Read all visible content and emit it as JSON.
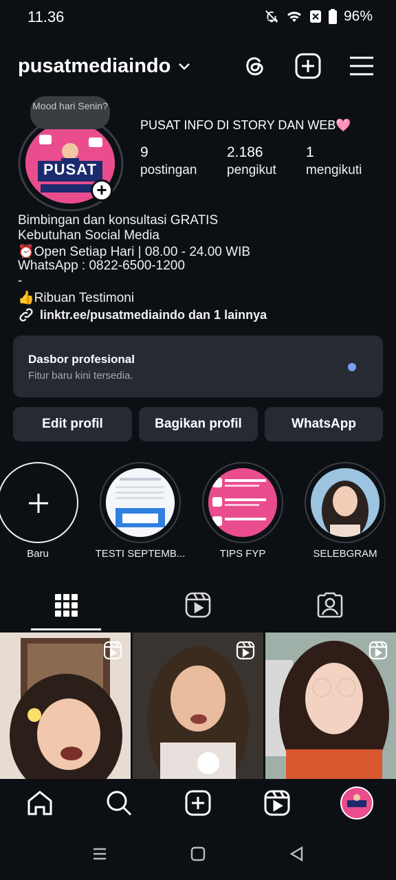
{
  "status_bar": {
    "time": "11.36",
    "battery": "96%"
  },
  "header": {
    "username": "pusatmediaindo"
  },
  "profile": {
    "mood_note": "Mood hari Senin?",
    "headline": "PUSAT INFO DI STORY DAN WEB🩷",
    "avatar_text": "PUSAT",
    "stats": [
      {
        "value": "9",
        "label": "postingan"
      },
      {
        "value": "2.186",
        "label": "pengikut"
      },
      {
        "value": "1",
        "label": "mengikuti"
      }
    ],
    "bio_lines": [
      "Bimbingan dan konsultasi GRATIS",
      "Kebutuhan Social Media",
      "⏰Open Setiap Hari | 08.00 - 24.00 WIB",
      "WhatsApp : 0822-6500-1200",
      "-",
      "👍Ribuan Testimoni"
    ],
    "link": "linktr.ee/pusatmediaindo dan 1 lainnya"
  },
  "dashboard": {
    "title": "Dasbor profesional",
    "subtitle": "Fitur baru kini tersedia."
  },
  "buttons": {
    "edit": "Edit profil",
    "share": "Bagikan profil",
    "whatsapp": "WhatsApp"
  },
  "highlights": [
    {
      "label": "Baru"
    },
    {
      "label": "TESTI SEPTEMB..."
    },
    {
      "label": "TIPS FYP"
    },
    {
      "label": "SELEBGRAM"
    }
  ],
  "colors": {
    "background": "#0c1014",
    "surface": "#262a33",
    "accent_dot": "#7b9df2",
    "brand_pink": "#e94d8d"
  }
}
